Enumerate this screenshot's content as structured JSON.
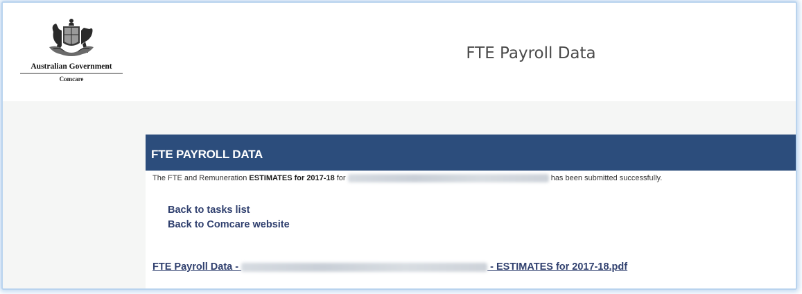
{
  "header": {
    "logo": {
      "government": "Australian Government",
      "agency": "Comcare",
      "icon": "coat-of-arms-icon"
    },
    "title": "FTE Payroll Data"
  },
  "panel": {
    "heading": "FTE PAYROLL DATA",
    "message": {
      "prefix": "The FTE and Remuneration ",
      "emphasis": "ESTIMATES for 2017-18",
      "for_word": " for ",
      "suffix": " has been submitted successfully."
    },
    "links": [
      {
        "label": "Back to tasks list"
      },
      {
        "label": "Back to Comcare website"
      }
    ],
    "pdf_link": {
      "prefix": "FTE Payroll Data - ",
      "suffix": " - ESTIMATES for 2017-18.pdf"
    }
  },
  "colors": {
    "panel_header_bg": "#2c4d7c",
    "link": "#2f3f6e",
    "title_text": "#4a4a4a",
    "frame_glow": "#b9d3ee"
  }
}
